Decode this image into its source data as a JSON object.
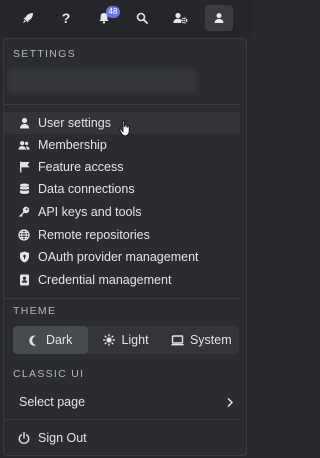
{
  "topbar": {
    "help_label": "?",
    "notification_count": "48"
  },
  "settings": {
    "section_title": "SETTINGS",
    "items": [
      {
        "label": "User settings",
        "icon": "user-icon"
      },
      {
        "label": "Membership",
        "icon": "people-icon"
      },
      {
        "label": "Feature access",
        "icon": "flag-icon"
      },
      {
        "label": "Data connections",
        "icon": "database-icon"
      },
      {
        "label": "API keys and tools",
        "icon": "key-icon"
      },
      {
        "label": "Remote repositories",
        "icon": "globe-icon"
      },
      {
        "label": "OAuth provider management",
        "icon": "shield-icon"
      },
      {
        "label": "Credential management",
        "icon": "id-card-icon"
      }
    ]
  },
  "theme": {
    "section_title": "THEME",
    "options": [
      {
        "label": "Dark",
        "icon": "moon-icon"
      },
      {
        "label": "Light",
        "icon": "sun-icon"
      },
      {
        "label": "System",
        "icon": "monitor-icon"
      }
    ],
    "selected": "Dark"
  },
  "classic_ui": {
    "section_title": "CLASSIC UI",
    "select_label": "Select page"
  },
  "sign_out_label": "Sign Out",
  "colors": {
    "background": "#27292c",
    "panel": "#2a2c2f",
    "accent_badge": "#6b74e6",
    "text": "#e3e5e8"
  }
}
